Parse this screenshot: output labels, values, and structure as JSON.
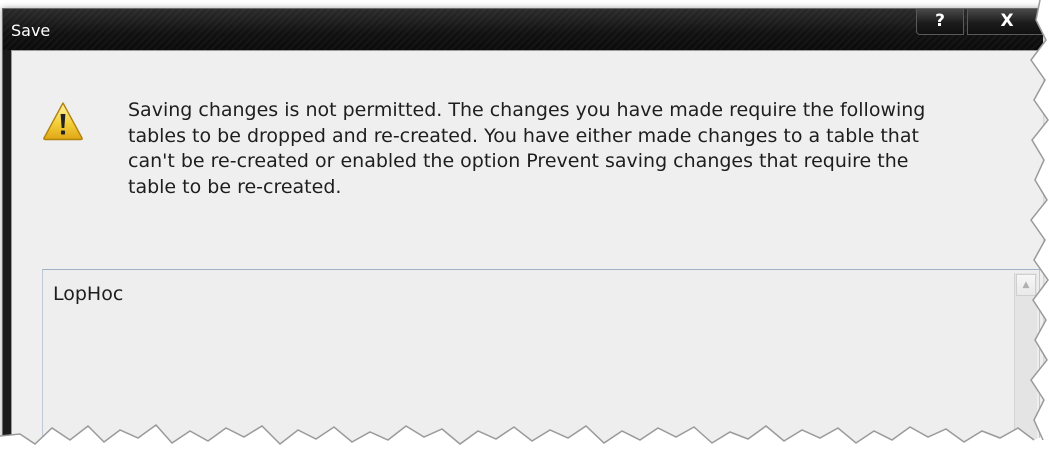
{
  "dialog": {
    "title": "Save",
    "help_button": "?",
    "close_button": "X",
    "icon": "warning-icon",
    "message": "Saving changes is not permitted. The changes you have made require the following\ntables to be dropped and re-created. You have either made changes to a table that\ncan't be re-created or enabled the option Prevent saving changes that require the\ntable to be re-created.",
    "tables": [
      "LopHoc"
    ],
    "scroll_up_icon": "scroll-up-arrow-icon"
  },
  "colors": {
    "titlebar": "#111111",
    "client_background": "#efefef",
    "warning_yellow": "#f2c230"
  }
}
